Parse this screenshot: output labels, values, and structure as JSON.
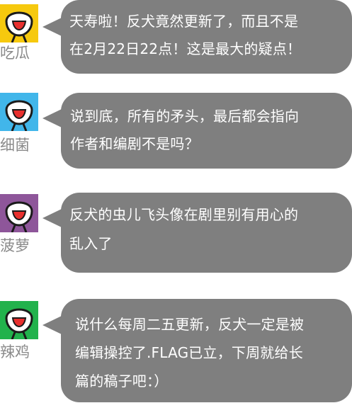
{
  "colors": {
    "bubble": "#7f7f7f",
    "bubble_text": "#ffffff",
    "name_text": "#8a8a8a",
    "face_outline": "#1a1a1a",
    "mouth": "#e8302e"
  },
  "messages": [
    {
      "user": "吃瓜",
      "avatar_icon": "smiley-face-icon",
      "avatar_bg": "#f6c90e",
      "lines": [
        "天寿啦！反犬竟然更新了，而且不是",
        "在2月22日22点！这是最大的疑点！"
      ]
    },
    {
      "user": "细菌",
      "avatar_icon": "smiley-face-icon",
      "avatar_bg": "#41b6ea",
      "lines": [
        "说到底，所有的矛头，最后都会指向",
        "作者和编剧不是吗？"
      ]
    },
    {
      "user": "菠萝",
      "avatar_icon": "smiley-face-icon",
      "avatar_bg": "#8e569a",
      "lines": [
        "反犬的虫儿飞头像在剧里别有用心的",
        "乱入了"
      ]
    },
    {
      "user": "辣鸡",
      "avatar_icon": "smiley-face-icon",
      "avatar_bg": "#22b24c",
      "lines": [
        "说什么每周二五更新，反犬一定是被",
        "编辑操控了.FLAG已立，下周就给长",
        "篇的稿子吧：）"
      ]
    }
  ]
}
